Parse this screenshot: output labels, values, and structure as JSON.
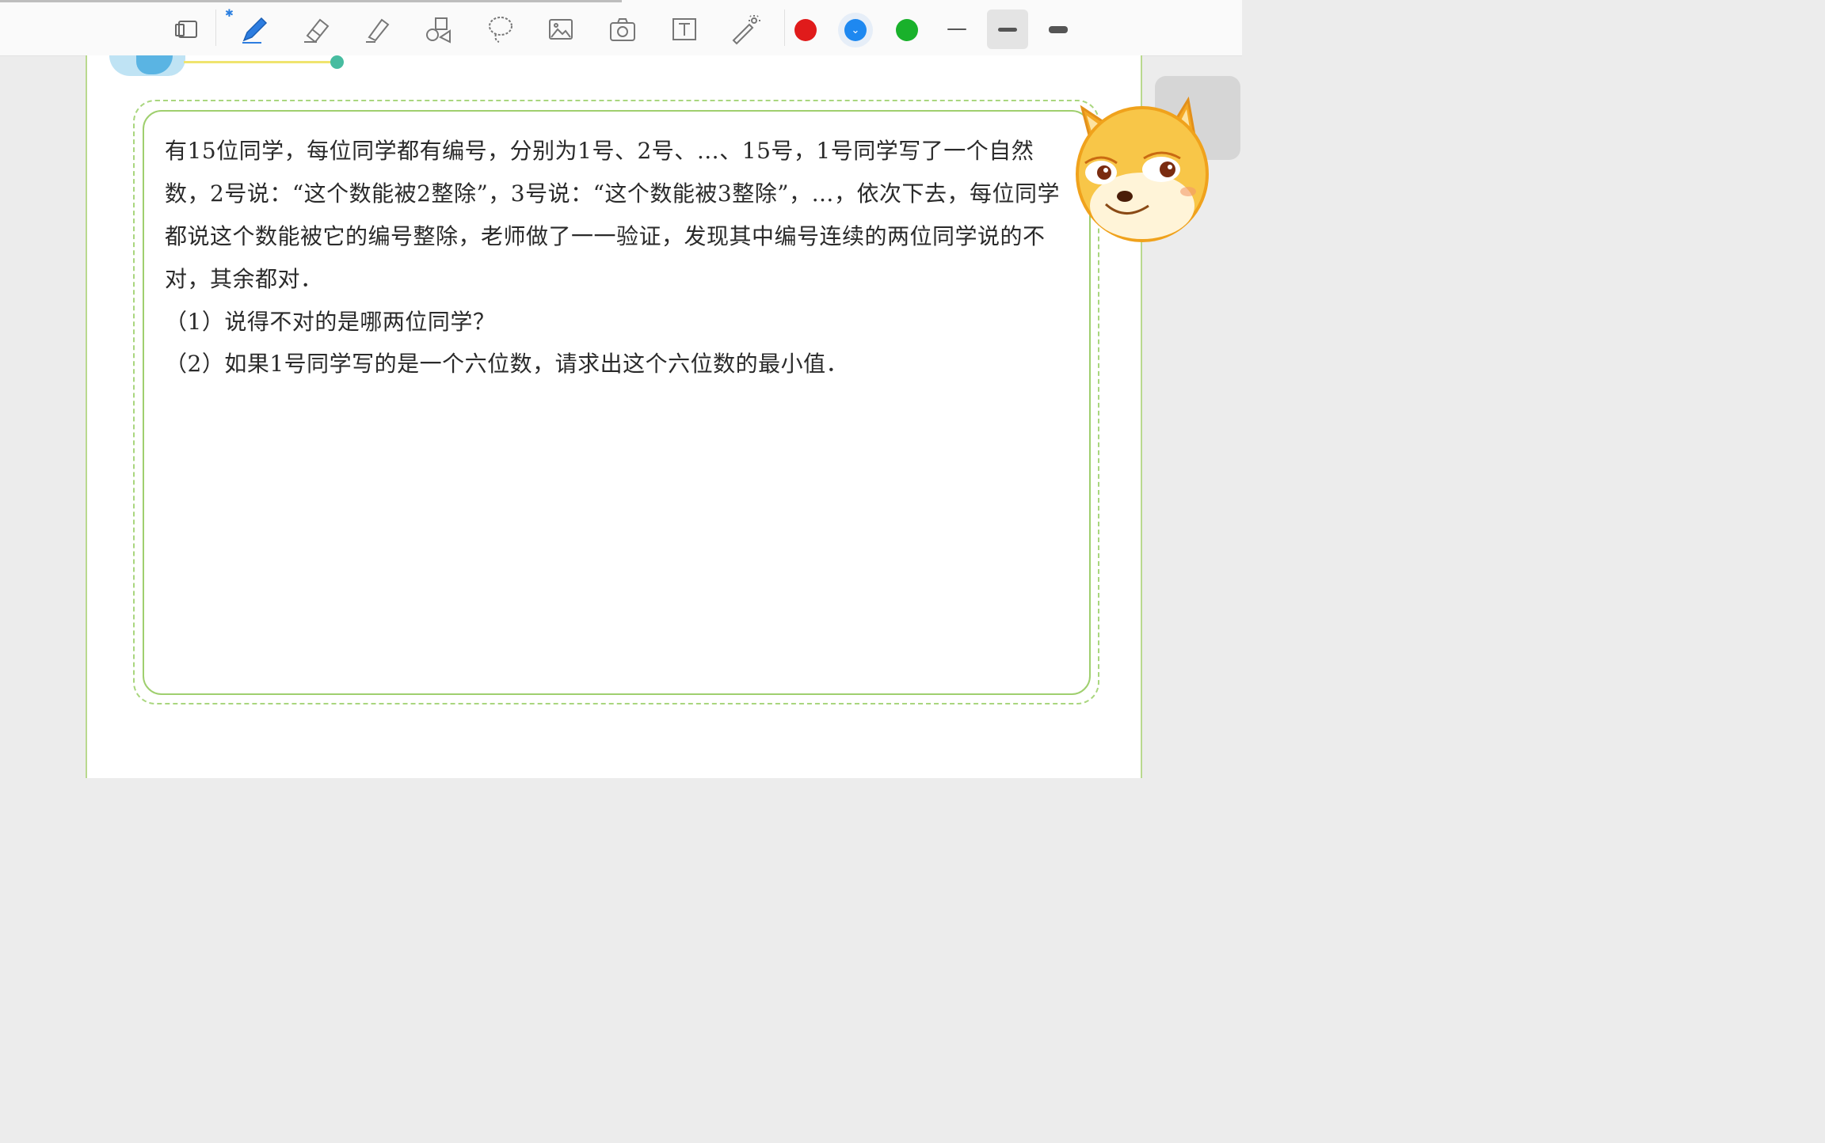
{
  "toolbar": {
    "tools": [
      {
        "icon": "tablet-screen-icon"
      },
      {
        "icon": "pen-icon",
        "selected": true
      },
      {
        "icon": "eraser-icon"
      },
      {
        "icon": "highlighter-icon"
      },
      {
        "icon": "shapes-icon"
      },
      {
        "icon": "lasso-icon"
      },
      {
        "icon": "image-icon"
      },
      {
        "icon": "camera-icon"
      },
      {
        "icon": "text-box-icon"
      },
      {
        "icon": "laser-pointer-icon"
      }
    ],
    "bluetooth_symbol": "✱",
    "colors": [
      "#e01b1b",
      "#1e88f0",
      "#19b12b"
    ],
    "selected_color": "#1e88f0",
    "selected_color_mark": "⌄",
    "selected_thickness": "medium"
  },
  "problem": {
    "paragraph": "有15位同学，每位同学都有编号，分别为1号、2号、…、15号，1号同学写了一个自然数，2号说：“这个数能被2整除”，3号说：“这个数能被3整除”，…，依次下去，每位同学都说这个数能被它的编号整除，老师做了一一验证，发现其中编号连续的两位同学说的不对，其余都对．",
    "q1": "（1）说得不对的是哪两位同学？",
    "q2": "（2）如果1号同学写的是一个六位数，请求出这个六位数的最小值．"
  },
  "colors": {
    "frame_green": "#9fcf6e",
    "page_border": "#b9d98e"
  }
}
